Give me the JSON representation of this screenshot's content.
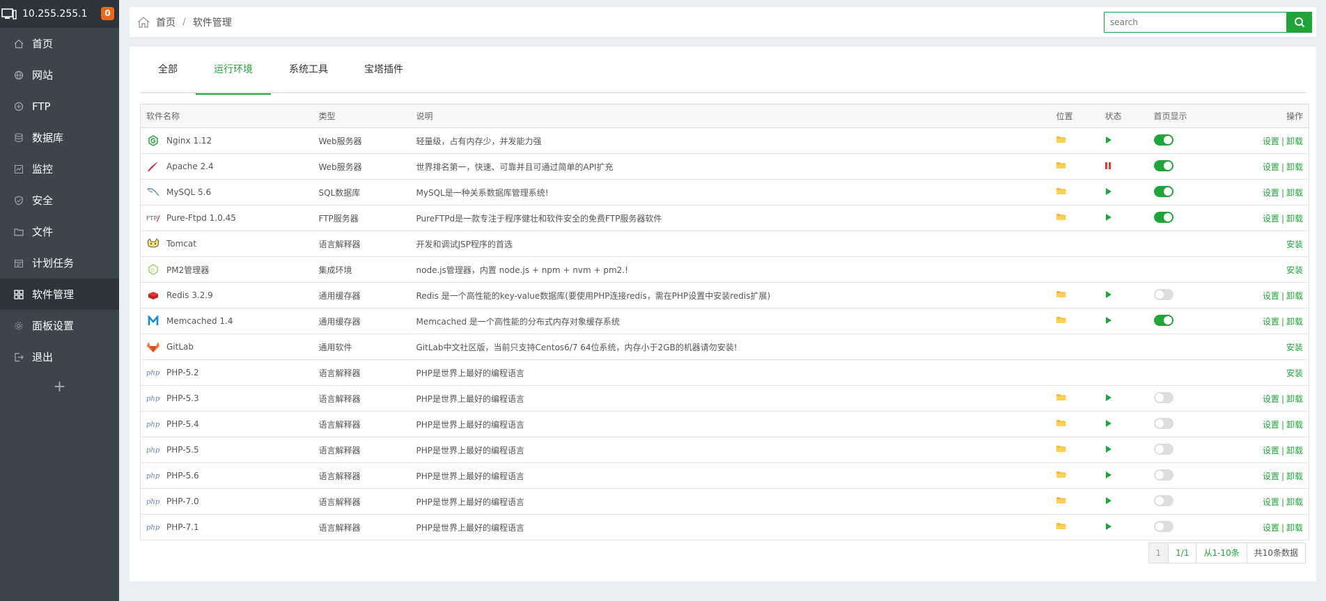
{
  "sidebar": {
    "ip": "10.255.255.1",
    "badge": "0",
    "items": [
      {
        "label": "首页",
        "icon": "home-icon",
        "active": false
      },
      {
        "label": "网站",
        "icon": "globe-icon",
        "active": false
      },
      {
        "label": "FTP",
        "icon": "ftp-icon",
        "active": false
      },
      {
        "label": "数据库",
        "icon": "database-icon",
        "active": false
      },
      {
        "label": "监控",
        "icon": "monitor-icon",
        "active": false
      },
      {
        "label": "安全",
        "icon": "shield-icon",
        "active": false
      },
      {
        "label": "文件",
        "icon": "folder-icon",
        "active": false
      },
      {
        "label": "计划任务",
        "icon": "calendar-icon",
        "active": false
      },
      {
        "label": "软件管理",
        "icon": "grid-icon",
        "active": true
      },
      {
        "label": "面板设置",
        "icon": "gear-icon",
        "active": false
      },
      {
        "label": "退出",
        "icon": "logout-icon",
        "active": false
      }
    ],
    "add": "+"
  },
  "breadcrumb": {
    "home": "首页",
    "sep": "/",
    "current": "软件管理"
  },
  "search": {
    "placeholder": "search"
  },
  "tabs": [
    {
      "label": "全部",
      "active": false
    },
    {
      "label": "运行环境",
      "active": true
    },
    {
      "label": "系统工具",
      "active": false
    },
    {
      "label": "宝塔插件",
      "active": false
    }
  ],
  "table": {
    "headers": {
      "name": "软件名称",
      "type": "类型",
      "desc": "说明",
      "loc": "位置",
      "status": "状态",
      "home": "首页显示",
      "op": "操作"
    },
    "rows": [
      {
        "name": "Nginx 1.12",
        "icon": "nginx-icon",
        "type": "Web服务器",
        "desc": "轻量级，占有内存少，并发能力强",
        "installed": true,
        "status": "running",
        "home_on": true
      },
      {
        "name": "Apache 2.4",
        "icon": "apache-icon",
        "type": "Web服务器",
        "desc": "世界排名第一，快速、可靠并且可通过简单的API扩充",
        "installed": true,
        "status": "stopped",
        "home_on": true
      },
      {
        "name": "MySQL 5.6",
        "icon": "mysql-icon",
        "type": "SQL数据库",
        "desc": "MySQL是一种关系数据库管理系统!",
        "installed": true,
        "status": "running",
        "home_on": true
      },
      {
        "name": "Pure-Ftpd 1.0.45",
        "icon": "ftp-logo-icon",
        "type": "FTP服务器",
        "desc": "PureFTPd是一款专注于程序健壮和软件安全的免费FTP服务器软件",
        "installed": true,
        "status": "running",
        "home_on": true
      },
      {
        "name": "Tomcat",
        "icon": "tomcat-icon",
        "type": "语言解释器",
        "desc": "开发和调试JSP程序的首选",
        "installed": false
      },
      {
        "name": "PM2管理器",
        "icon": "nodejs-icon",
        "type": "集成环境",
        "desc": "node.js管理器，内置 node.js + npm + nvm + pm2.!",
        "installed": false
      },
      {
        "name": "Redis 3.2.9",
        "icon": "redis-icon",
        "type": "通用缓存器",
        "desc": "Redis 是一个高性能的key-value数据库(要使用PHP连接redis，需在PHP设置中安装redis扩展)",
        "installed": true,
        "status": "running",
        "home_on": false
      },
      {
        "name": "Memcached 1.4",
        "icon": "memcached-icon",
        "type": "通用缓存器",
        "desc": "Memcached 是一个高性能的分布式内存对象缓存系统",
        "installed": true,
        "status": "running",
        "home_on": true
      },
      {
        "name": "GitLab",
        "icon": "gitlab-icon",
        "type": "通用软件",
        "desc": "GitLab中文社区版，当前只支持Centos6/7 64位系统，内存小于2GB的机器请勿安装!",
        "installed": false
      },
      {
        "name": "PHP-5.2",
        "icon": "php-icon",
        "type": "语言解释器",
        "desc": "PHP是世界上最好的编程语言",
        "installed": false
      },
      {
        "name": "PHP-5.3",
        "icon": "php-icon",
        "type": "语言解释器",
        "desc": "PHP是世界上最好的编程语言",
        "installed": true,
        "status": "running",
        "home_on": false
      },
      {
        "name": "PHP-5.4",
        "icon": "php-icon",
        "type": "语言解释器",
        "desc": "PHP是世界上最好的编程语言",
        "installed": true,
        "status": "running",
        "home_on": false
      },
      {
        "name": "PHP-5.5",
        "icon": "php-icon",
        "type": "语言解释器",
        "desc": "PHP是世界上最好的编程语言",
        "installed": true,
        "status": "running",
        "home_on": false
      },
      {
        "name": "PHP-5.6",
        "icon": "php-icon",
        "type": "语言解释器",
        "desc": "PHP是世界上最好的编程语言",
        "installed": true,
        "status": "running",
        "home_on": false
      },
      {
        "name": "PHP-7.0",
        "icon": "php-icon",
        "type": "语言解释器",
        "desc": "PHP是世界上最好的编程语言",
        "installed": true,
        "status": "running",
        "home_on": false
      },
      {
        "name": "PHP-7.1",
        "icon": "php-icon",
        "type": "语言解释器",
        "desc": "PHP是世界上最好的编程语言",
        "installed": true,
        "status": "running",
        "home_on": false
      }
    ],
    "settings_label": "设置",
    "pipe": "|",
    "uninstall_label": "卸载",
    "install_label": "安装"
  },
  "pager": {
    "page": "1",
    "pages": "1/1",
    "range": "从1-10条",
    "total": "共10条数据"
  },
  "colors": {
    "accent": "#20a53a",
    "sidebar": "#3c444d",
    "badge": "#f0671b",
    "stopped": "#e33"
  }
}
